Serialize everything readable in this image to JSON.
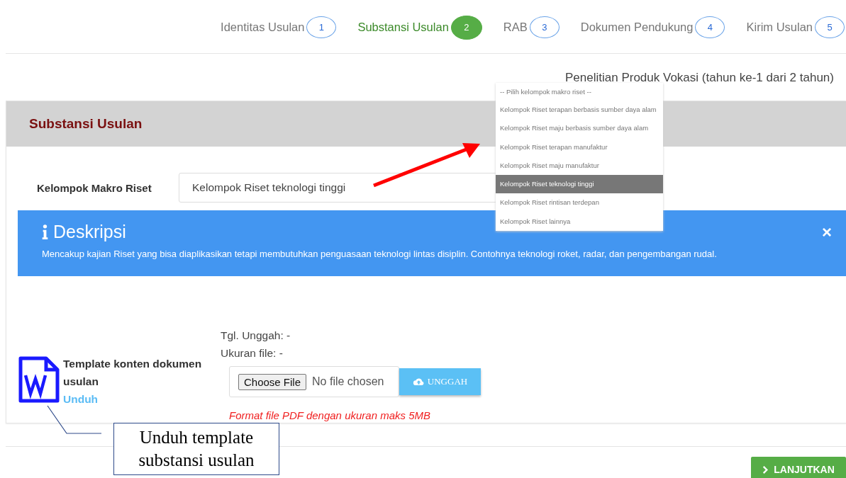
{
  "steps": [
    {
      "label": "Identitas Usulan",
      "number": "1",
      "selected": false
    },
    {
      "label": "Substansi Usulan",
      "number": "2",
      "selected": true
    },
    {
      "label": "RAB",
      "number": "3",
      "selected": false
    },
    {
      "label": "Dokumen Pendukung",
      "number": "4",
      "selected": false
    },
    {
      "label": "Kirim Usulan",
      "number": "5",
      "selected": false
    }
  ],
  "program_title": "Penelitian Produk Vokasi (tahun ke-1 dari 2 tahun)",
  "card": {
    "title": "Substansi Usulan",
    "field": {
      "label": "Kelompok Makro Riset",
      "value": "Kelompok Riset teknologi tinggi"
    },
    "alert": {
      "title": "Deskripsi",
      "text": "Mencakup kajian Riset yang bisa diaplikasikan tetapi membutuhkan penguasaan teknologi lintas disiplin. Contohnya teknologi roket, radar, dan pengembangan rudal.",
      "close": "×"
    },
    "template": {
      "title": "Template konten dokumen usulan",
      "link": "Unduh"
    },
    "upload": {
      "date": "Tgl. Unggah: -",
      "size": "Ukuran file: -",
      "choose_button": "Choose File",
      "file_status": "No file chosen",
      "upload_button": "UNGGAH",
      "hint": "Format file PDF dengan ukuran maks 5MB"
    }
  },
  "dropdown": {
    "options": [
      {
        "label": "-- Pilih kelompok makro riset --",
        "selected": false
      },
      {
        "label": "Kelompok Riset terapan berbasis sumber daya alam",
        "selected": false
      },
      {
        "label": "Kelompok Riset maju berbasis sumber daya alam",
        "selected": false
      },
      {
        "label": "Kelompok Riset terapan manufaktur",
        "selected": false
      },
      {
        "label": "Kelompok Riset maju manufaktur",
        "selected": false
      },
      {
        "label": "Kelompok Riset teknologi tinggi",
        "selected": true
      },
      {
        "label": "Kelompok Riset rintisan terdepan",
        "selected": false
      },
      {
        "label": "Kelompok Riset lainnya",
        "selected": false
      }
    ]
  },
  "callout": {
    "text": "Unduh template substansi usulan"
  },
  "next_button": "LANJUTKAN"
}
